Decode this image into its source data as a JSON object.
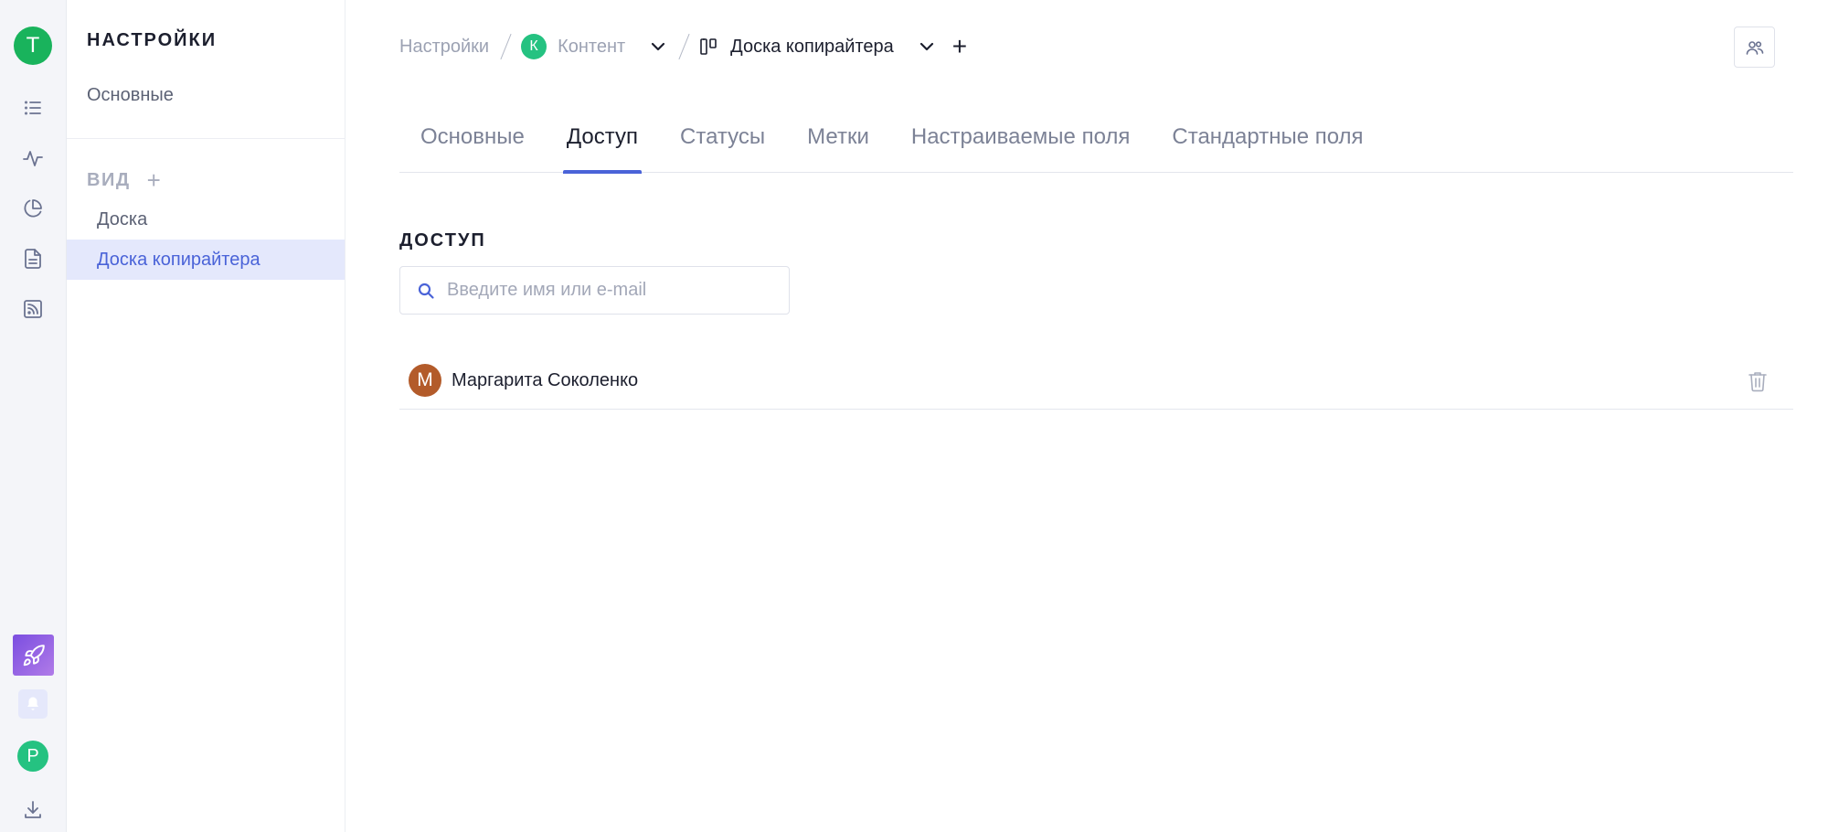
{
  "rail": {
    "workspace_initial": "T",
    "nav_icons": [
      "list-icon",
      "activity-icon",
      "pie-chart-icon",
      "document-icon",
      "feed-icon"
    ],
    "user_initial": "P",
    "bottom_icons": [
      "rocket-icon",
      "bell-icon",
      "download-icon"
    ]
  },
  "sidebar": {
    "title": "НАСТРОЙКИ",
    "main_link": "Основные",
    "views_section": "ВИД",
    "views_add": "+",
    "views": [
      {
        "label": "Доска",
        "active": false
      },
      {
        "label": "Доска копирайтера",
        "active": true
      }
    ]
  },
  "breadcrumb": {
    "settings": "Настройки",
    "project_initial": "К",
    "project": "Контент",
    "board": "Доска копирайтера",
    "add": "+"
  },
  "tabs": [
    {
      "label": "Основные",
      "active": false
    },
    {
      "label": "Доступ",
      "active": true
    },
    {
      "label": "Статусы",
      "active": false
    },
    {
      "label": "Метки",
      "active": false
    },
    {
      "label": "Настраиваемые поля",
      "active": false
    },
    {
      "label": "Стандартные поля",
      "active": false
    }
  ],
  "access": {
    "heading": "ДОСТУП",
    "search_placeholder": "Введите имя или e-mail",
    "search_value": "",
    "members": [
      {
        "initial": "М",
        "name": "Маргарита Соколенко"
      }
    ]
  },
  "colors": {
    "accent": "#4a63d8",
    "workspace_avatar": "#19b35c",
    "green_avatar": "#25c281",
    "member_avatar": "#b35b2a",
    "active_item_bg": "#e4e8fc"
  }
}
